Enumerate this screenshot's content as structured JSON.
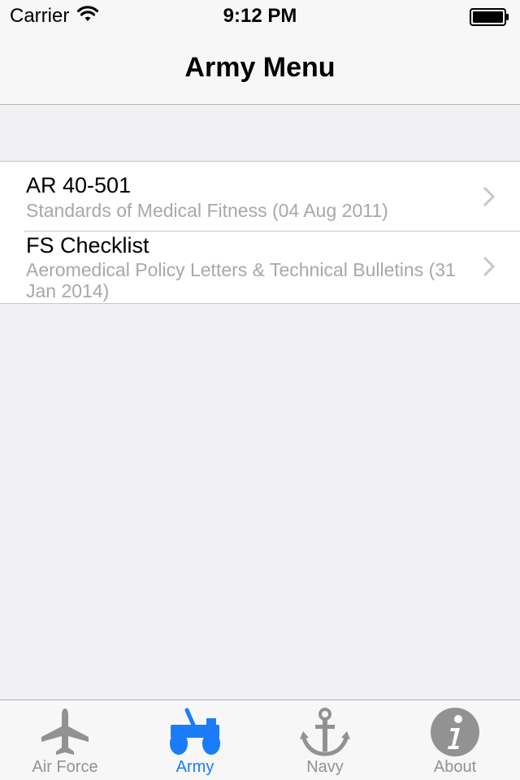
{
  "status_bar": {
    "carrier": "Carrier",
    "time": "9:12 PM"
  },
  "nav": {
    "title": "Army Menu"
  },
  "rows": [
    {
      "title": "AR 40-501",
      "subtitle": "Standards of Medical Fitness (04 Aug 2011)"
    },
    {
      "title": "FS Checklist",
      "subtitle": "Aeromedical Policy Letters & Technical Bulletins (31 Jan 2014)"
    }
  ],
  "tabs": [
    {
      "label": "Air Force",
      "icon": "airplane-icon"
    },
    {
      "label": "Army",
      "icon": "jeep-icon"
    },
    {
      "label": "Navy",
      "icon": "anchor-icon"
    },
    {
      "label": "About",
      "icon": "info-icon"
    }
  ],
  "selected_tab": "Army",
  "colors": {
    "accent": "#1a7cf9",
    "inactive": "#929292",
    "background": "#efeff4",
    "bar": "#f7f7f7",
    "subtitle": "#a8a8ac",
    "chevron": "#c7c7cc"
  }
}
